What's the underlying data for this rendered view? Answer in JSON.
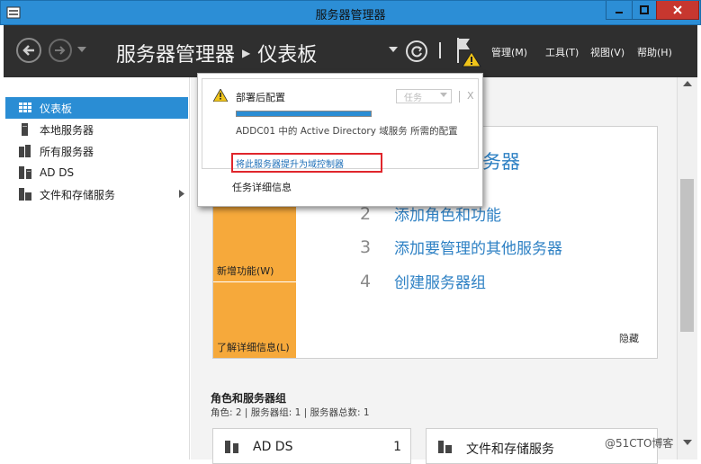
{
  "window": {
    "title": "服务器管理器",
    "buttons": {
      "minimize": "minimize",
      "maximize": "maximize",
      "close": "close"
    }
  },
  "header": {
    "breadcrumb_root": "服务器管理器",
    "breadcrumb_current": "仪表板",
    "menus": [
      "管理(M)",
      "工具(T)",
      "视图(V)",
      "帮助(H)"
    ]
  },
  "sidebar": {
    "items": [
      {
        "label": "仪表板",
        "icon": "dashboard-icon",
        "active": true
      },
      {
        "label": "本地服务器",
        "icon": "local-server-icon"
      },
      {
        "label": "所有服务器",
        "icon": "all-servers-icon"
      },
      {
        "label": "AD DS",
        "icon": "ad-ds-icon"
      },
      {
        "label": "文件和存储服务",
        "icon": "file-storage-icon",
        "expandable": true
      }
    ]
  },
  "notification": {
    "title": "部署后配置",
    "task_button": "任务",
    "close_label": "X",
    "progress": 1.0,
    "message": "ADDC01 中的 Active Directory 域服务 所需的配置",
    "link": "将此服务器提升为域控制器",
    "details": "任务详细信息"
  },
  "welcome": {
    "heading_fragment": "务器",
    "tiles": [
      "新增功能(W)",
      "了解详细信息(L)"
    ],
    "steps": [
      {
        "num": "2",
        "label": "添加角色和功能"
      },
      {
        "num": "3",
        "label": "添加要管理的其他服务器"
      },
      {
        "num": "4",
        "label": "创建服务器组"
      }
    ],
    "hide": "隐藏"
  },
  "roles": {
    "title": "角色和服务器组",
    "subtitle": "角色: 2 | 服务器组: 1 | 服务器总数: 1",
    "cards": [
      {
        "name": "AD DS",
        "count": "1"
      },
      {
        "name": "文件和存储服务",
        "count": ""
      }
    ]
  },
  "watermark": "@51CTO博客",
  "colors": {
    "title_bar": "#2c8ed6",
    "header": "#2f2f2f",
    "accent": "#2a8dd4",
    "tile": "#f6a93b",
    "highlight": "#e0262c",
    "warning": "#f0c419"
  }
}
